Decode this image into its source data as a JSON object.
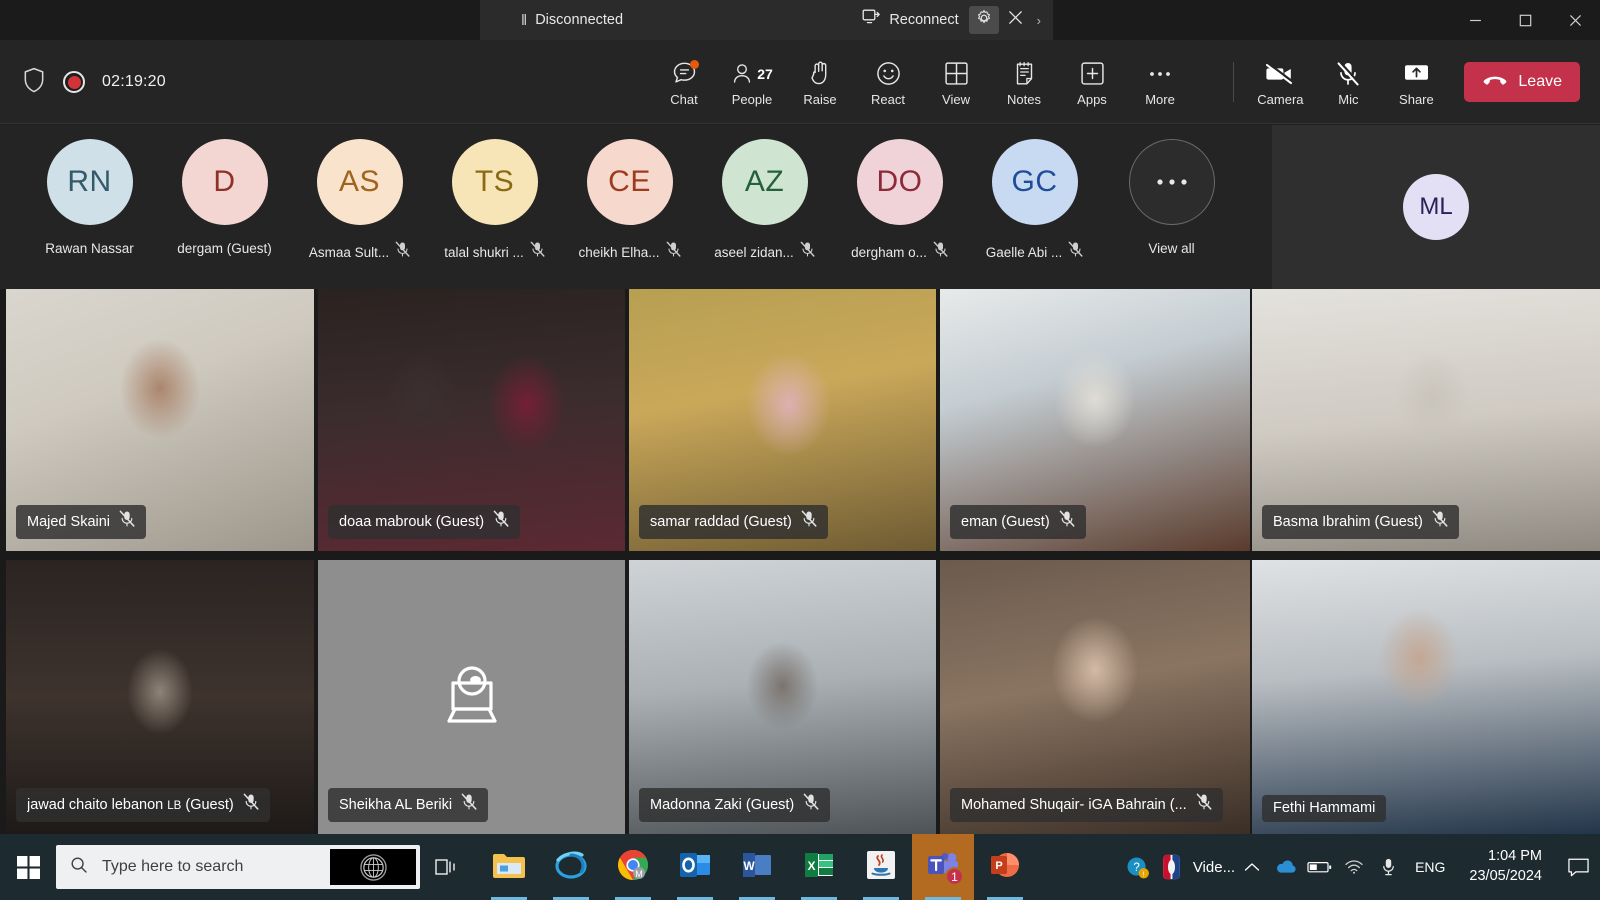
{
  "titlebar": {
    "status_text": "Disconnected",
    "pause_glyph": "‖",
    "reconnect_label": "Reconnect",
    "settings_icon": "gear-icon",
    "close_icon": "close-icon",
    "overflow_chevron": "›",
    "minimize_label": "Minimize",
    "maximize_label": "Maximize",
    "close_label": "Close"
  },
  "meeting_bar": {
    "shield_icon": "shield-icon",
    "recording_icon": "recording-icon",
    "timer": "02:19:20",
    "tools": [
      {
        "label": "Chat",
        "icon": "chat-icon",
        "badge": true
      },
      {
        "label": "People",
        "icon": "people-icon",
        "count": "27"
      },
      {
        "label": "Raise",
        "icon": "raise-hand-icon"
      },
      {
        "label": "React",
        "icon": "react-smiley-icon"
      },
      {
        "label": "View",
        "icon": "view-grid-icon"
      },
      {
        "label": "Notes",
        "icon": "notes-icon"
      },
      {
        "label": "Apps",
        "icon": "apps-plus-icon"
      },
      {
        "label": "More",
        "icon": "more-ellipsis-icon"
      }
    ],
    "right_tools": [
      {
        "label": "Camera",
        "icon": "camera-off-icon"
      },
      {
        "label": "Mic",
        "icon": "mic-off-icon"
      },
      {
        "label": "Share",
        "icon": "share-screen-icon"
      }
    ],
    "leave_label": "Leave",
    "leave_icon": "hangup-phone-icon",
    "leave_color": "#c4314b"
  },
  "avatar_strip": {
    "participants": [
      {
        "initials": "RN",
        "name": "Rawan Nassar",
        "bg": "#cfe0e8",
        "fg": "#335a6b",
        "muted": false
      },
      {
        "initials": "D",
        "name": "dergam (Guest)",
        "bg": "#f3d6d2",
        "fg": "#8e3227",
        "muted": false
      },
      {
        "initials": "AS",
        "name": "Asmaa Sult...",
        "bg": "#fae3cc",
        "fg": "#a0651d",
        "muted": true
      },
      {
        "initials": "TS",
        "name": "talal shukri ...",
        "bg": "#f7e5b8",
        "fg": "#8a6a15",
        "muted": true
      },
      {
        "initials": "CE",
        "name": "cheikh Elha...",
        "bg": "#f6d8cd",
        "fg": "#9e3a1f",
        "muted": true
      },
      {
        "initials": "AZ",
        "name": "aseel zidan...",
        "bg": "#cfe5d2",
        "fg": "#24603a",
        "muted": true
      },
      {
        "initials": "DO",
        "name": "dergham o...",
        "bg": "#f0d3d8",
        "fg": "#8c2a3a",
        "muted": true
      },
      {
        "initials": "GC",
        "name": "Gaelle Abi ...",
        "bg": "#c8d9f2",
        "fg": "#1f4e99",
        "muted": true
      }
    ],
    "view_all_label": "View all",
    "view_all_icon": "ellipsis-icon",
    "self_initials": "ML"
  },
  "video_grid": {
    "tiles": [
      {
        "name": "Majed Skaini",
        "muted": true,
        "has_video": true,
        "row": 1
      },
      {
        "name": "doaa mabrouk (Guest)",
        "muted": true,
        "has_video": true,
        "row": 1
      },
      {
        "name": "samar raddad (Guest)",
        "muted": true,
        "has_video": true,
        "row": 1
      },
      {
        "name": "eman (Guest)",
        "muted": true,
        "has_video": true,
        "row": 1
      },
      {
        "name": "Basma Ibrahim (Guest)",
        "muted": true,
        "has_video": true,
        "row": 1
      },
      {
        "name": "jawad chaito lebanon LB (Guest)",
        "muted": true,
        "has_video": true,
        "row": 2
      },
      {
        "name": "Sheikha AL Beriki",
        "muted": true,
        "has_video": false,
        "row": 2,
        "placeholder_icon": "webcam-laptop-icon"
      },
      {
        "name": "Madonna Zaki (Guest)",
        "muted": true,
        "has_video": true,
        "row": 2
      },
      {
        "name": "Mohamed Shuqair- iGA Bahrain (...",
        "muted": true,
        "has_video": true,
        "row": 2
      },
      {
        "name": "Fethi Hammami",
        "muted": false,
        "has_video": true,
        "row": 2
      }
    ]
  },
  "taskbar": {
    "start_icon": "windows-start-icon",
    "search_placeholder": "Type here to search",
    "search_icon": "search-icon",
    "search_thumbnail_icon": "un-emblem-icon",
    "task_view_icon": "task-view-icon",
    "apps": [
      {
        "name": "file-explorer",
        "label": "File Explorer",
        "open": true,
        "active": false
      },
      {
        "name": "internet-explorer",
        "label": "Internet Explorer",
        "open": true,
        "active": false
      },
      {
        "name": "chrome",
        "label": "Google Chrome",
        "open": true,
        "active": false
      },
      {
        "name": "outlook",
        "label": "Outlook",
        "open": true,
        "active": false
      },
      {
        "name": "word",
        "label": "Word",
        "open": true,
        "active": false
      },
      {
        "name": "excel",
        "label": "Excel",
        "open": true,
        "active": false
      },
      {
        "name": "java",
        "label": "Java",
        "open": true,
        "active": false
      },
      {
        "name": "teams",
        "label": "Microsoft Teams",
        "open": true,
        "active": true,
        "badge": "1"
      },
      {
        "name": "powerpoint",
        "label": "PowerPoint",
        "open": true,
        "active": false
      }
    ],
    "tray_items": [
      {
        "name": "help-warning-icon"
      },
      {
        "name": "nba-app-icon"
      }
    ],
    "window_label": "Vide...",
    "overflow_chevron": "⌃",
    "onedrive_icon": "onedrive-cloud-icon",
    "battery_icon": "battery-icon",
    "network_icon": "wifi-icon",
    "mic_tray_icon": "microphone-icon",
    "language": "ENG",
    "time": "1:04 PM",
    "date": "23/05/2024",
    "action_center_icon": "notification-icon"
  }
}
